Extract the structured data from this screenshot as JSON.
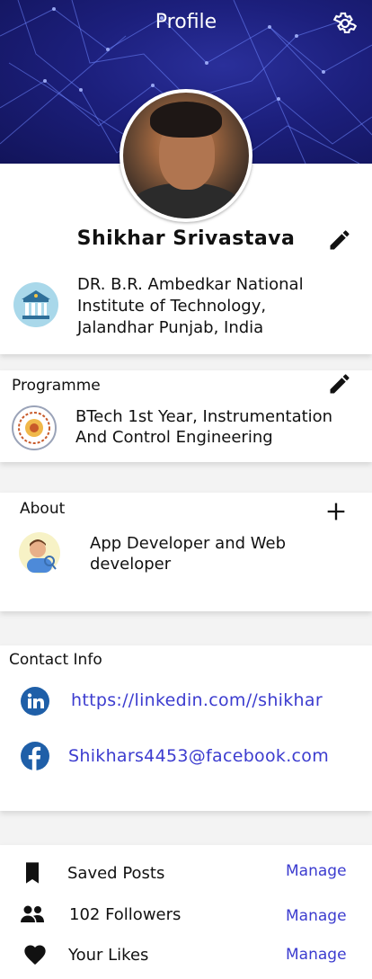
{
  "header": {
    "title": "Profile",
    "settings_icon": "gear-icon",
    "background_color": "#1c1f7c"
  },
  "profile": {
    "name": "Shikhar Srivastava",
    "institute_line1": "DR. B.R. Ambedkar National",
    "institute_line2": "Institute of Technology,",
    "institute_line3": "Jalandhar Punjab, India"
  },
  "programme": {
    "title": "Programme",
    "line1": "BTech 1st Year, Instrumentation",
    "line2": "And Control Engineering"
  },
  "about": {
    "title": "About",
    "line1": "App Developer and Web",
    "line2": "developer"
  },
  "contact": {
    "title": "Contact Info",
    "linkedin": "https://linkedin.com//shikhar",
    "facebook": "Shikhars4453@facebook.com",
    "link_color": "#3c3ccf"
  },
  "list": [
    {
      "icon": "bookmark-icon",
      "label": "Saved Posts",
      "action": "Manage"
    },
    {
      "icon": "people-icon",
      "label": "102 Followers",
      "action": "Manage"
    },
    {
      "icon": "heart-icon",
      "label": "Your Likes",
      "action": "Manage"
    }
  ]
}
